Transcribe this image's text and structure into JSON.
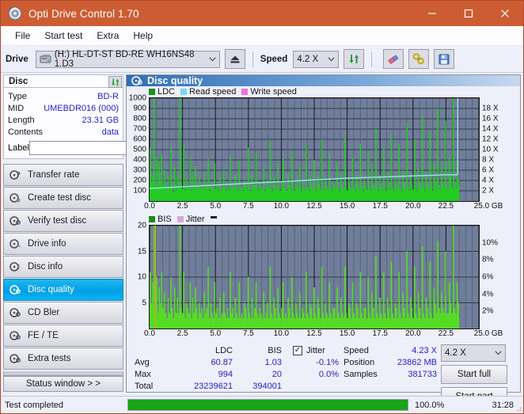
{
  "window": {
    "title": "Opti Drive Control 1.70",
    "icon": "disc-icon",
    "minimize": "—",
    "maximize": "☐",
    "close": "✕",
    "titlebar_color": "#cc5d33"
  },
  "menu": {
    "items": [
      "File",
      "Start test",
      "Extra",
      "Help"
    ]
  },
  "toolbar": {
    "drive_label": "Drive",
    "drive_value": "(H:)  HL-DT-ST BD-RE  WH16NS48 1.D3",
    "eject_icon": "eject-icon",
    "speed_label": "Speed",
    "speed_value": "4.2 X",
    "refresh_icon": "refresh-icon",
    "erase_icon": "eraser-icon",
    "tools_icon": "tools-icon",
    "save_icon": "save-icon",
    "chevron": "⌄"
  },
  "disc": {
    "group_title": "Disc",
    "refresh_icon": "refresh-icon",
    "rows": [
      {
        "key": "Type",
        "value": "BD-R"
      },
      {
        "key": "MID",
        "value": "UMEBDR016 (000)"
      },
      {
        "key": "Length",
        "value": "23.31 GB"
      },
      {
        "key": "Contents",
        "value": "data"
      }
    ],
    "label_key": "Label",
    "label_value": "",
    "label_placeholder": "",
    "label_icon": "cd-icon"
  },
  "nav": {
    "items": [
      {
        "label": "Transfer rate",
        "icon": "disc-rate-icon",
        "active": false
      },
      {
        "label": "Create test disc",
        "icon": "disc-create-icon",
        "active": false
      },
      {
        "label": "Verify test disc",
        "icon": "disc-verify-icon",
        "active": false
      },
      {
        "label": "Drive info",
        "icon": "disc-drive-icon",
        "active": false
      },
      {
        "label": "Disc info",
        "icon": "disc-info-icon",
        "active": false
      },
      {
        "label": "Disc quality",
        "icon": "disc-quality-icon",
        "active": true
      },
      {
        "label": "CD Bler",
        "icon": "disc-bler-icon",
        "active": false
      },
      {
        "label": "FE / TE",
        "icon": "disc-fete-icon",
        "active": false
      },
      {
        "label": "Extra tests",
        "icon": "disc-extra-icon",
        "active": false
      }
    ],
    "status_button": "Status window > >"
  },
  "panel": {
    "title": "Disc quality",
    "icon": "disc-quality-icon"
  },
  "chart_data": [
    {
      "type": "area",
      "name": "top-chart",
      "title": "",
      "xlabel": "GB",
      "ylabel": "",
      "xlim": [
        0,
        25
      ],
      "ylim": [
        0,
        1000
      ],
      "y2lim": [
        0,
        18
      ],
      "grid": true,
      "legend_position": "top-left",
      "legend": [
        {
          "label": "LDC",
          "color": "#1a8f1a"
        },
        {
          "label": "Read speed",
          "color": "#7fd4f0"
        },
        {
          "label": "Write speed",
          "color": "#f070d8"
        }
      ],
      "xticks": [
        "0.0",
        "2.5",
        "5.0",
        "7.5",
        "10.0",
        "12.5",
        "15.0",
        "17.5",
        "20.0",
        "22.5",
        "25.0"
      ],
      "yticks": [
        100,
        200,
        300,
        400,
        500,
        600,
        700,
        800,
        900,
        1000
      ],
      "y2ticks": [
        "2 X",
        "4 X",
        "6 X",
        "8 X",
        "10 X",
        "12 X",
        "14 X",
        "16 X",
        "18 X"
      ],
      "xunit": "GB",
      "series": [
        {
          "name": "LDC",
          "color": "#22cc22",
          "x_end": 23.5,
          "baseline": 90,
          "values": [
            520,
            180,
            240,
            1000,
            150,
            430,
            120,
            380,
            200,
            460,
            140,
            300,
            170,
            110,
            250,
            130,
            520,
            160,
            90,
            330,
            110,
            240,
            140,
            1000,
            180,
            120,
            560,
            100,
            210,
            150,
            130,
            420,
            100,
            260,
            120,
            340,
            150,
            110,
            230,
            130,
            170,
            110,
            280,
            120,
            150,
            420,
            100,
            190,
            130,
            110,
            370,
            120,
            160,
            100,
            230,
            110,
            140,
            300,
            120,
            100,
            180,
            110,
            440,
            120,
            150,
            110,
            260,
            130,
            100,
            390,
            110,
            140,
            100,
            200,
            170,
            110,
            520,
            130,
            100,
            250,
            110,
            160,
            470,
            120,
            100,
            180,
            140,
            110,
            320,
            100,
            130,
            200,
            110,
            580,
            120,
            100,
            240,
            150,
            110,
            360,
            120,
            100,
            190,
            420,
            110,
            130,
            100,
            270,
            160,
            110,
            480,
            120,
            100,
            210,
            140,
            110,
            340,
            100,
            180,
            120,
            110,
            540,
            130,
            100,
            230,
            150,
            110,
            400,
            120,
            100,
            260,
            170,
            110,
            600,
            120,
            100,
            210,
            140,
            110,
            460,
            130,
            100,
            190,
            160,
            110,
            380,
            120,
            100,
            280,
            140,
            110,
            620,
            130,
            100,
            220,
            150,
            110,
            430,
            120,
            100,
            240,
            170,
            110,
            560,
            130,
            100,
            200,
            150,
            110,
            480,
            120,
            100,
            320,
            160,
            110,
            700,
            130,
            100,
            250,
            140,
            110,
            520,
            120,
            100,
            280,
            170,
            110,
            640,
            130,
            100,
            230,
            150,
            110,
            560,
            120,
            100,
            300,
            180,
            110,
            760,
            140,
            100,
            260,
            160,
            110,
            600,
            130,
            100,
            320,
            190,
            110,
            820,
            150,
            100,
            280,
            170,
            110,
            680,
            140,
            100,
            360,
            200,
            120,
            900,
            160,
            110,
            340,
            190,
            120,
            780,
            150,
            110,
            420,
            230,
            130,
            1000,
            180,
            120,
            400,
            210
          ]
        },
        {
          "name": "Read speed",
          "color": "#9fe3f7",
          "note": "rising step curve from ~2.2X to ~4.6X across disc, vertical spike to 18X at ~23.4 GB",
          "points": [
            [
              0,
              2.2
            ],
            [
              2.5,
              2.5
            ],
            [
              5.0,
              2.8
            ],
            [
              7.5,
              3.1
            ],
            [
              10.0,
              3.4
            ],
            [
              12.5,
              3.7
            ],
            [
              15.0,
              4.0
            ],
            [
              17.5,
              4.2
            ],
            [
              20.0,
              4.4
            ],
            [
              22.5,
              4.6
            ],
            [
              23.4,
              4.6
            ]
          ]
        }
      ]
    },
    {
      "type": "area",
      "name": "bottom-chart",
      "title": "",
      "xlabel": "GB",
      "ylabel": "",
      "xlim": [
        0,
        25
      ],
      "ylim": [
        0,
        20
      ],
      "y2lim": [
        0,
        10
      ],
      "grid": true,
      "legend_position": "top-left",
      "legend": [
        {
          "label": "BIS",
          "color": "#1a8f1a"
        },
        {
          "label": "Jitter",
          "color": "#d9a8d9"
        }
      ],
      "xticks": [
        "0.0",
        "2.5",
        "5.0",
        "7.5",
        "10.0",
        "12.5",
        "15.0",
        "17.5",
        "20.0",
        "22.5",
        "25.0"
      ],
      "yticks": [
        5,
        10,
        15,
        20
      ],
      "y2ticks": [
        "2%",
        "4%",
        "6%",
        "8%",
        "10%"
      ],
      "xunit": "GB",
      "series": [
        {
          "name": "BIS",
          "color": "#55dd22",
          "x_end": 23.5,
          "values": [
            11,
            5,
            9,
            20,
            4,
            10,
            3,
            8,
            5,
            11,
            4,
            7,
            3,
            2,
            6,
            3,
            10,
            4,
            2,
            8,
            3,
            6,
            3,
            20,
            4,
            3,
            11,
            2,
            5,
            4,
            3,
            9,
            2,
            6,
            3,
            8,
            4,
            2,
            5,
            3,
            4,
            2,
            7,
            3,
            4,
            12,
            2,
            5,
            3,
            2,
            9,
            3,
            4,
            2,
            6,
            2,
            3,
            7,
            3,
            2,
            4,
            2,
            11,
            3,
            4,
            2,
            6,
            3,
            2,
            9,
            2,
            3,
            2,
            5,
            4,
            2,
            10,
            3,
            2,
            6,
            2,
            4,
            9,
            3,
            2,
            4,
            3,
            2,
            7,
            2,
            3,
            5,
            2,
            12,
            3,
            2,
            6,
            4,
            2,
            8,
            3,
            2,
            4,
            9,
            2,
            3,
            2,
            6,
            4,
            2,
            10,
            3,
            2,
            5,
            3,
            2,
            7,
            2,
            4,
            3,
            2,
            11,
            3,
            2,
            5,
            4,
            2,
            8,
            3,
            2,
            6,
            4,
            2,
            12,
            3,
            2,
            5,
            3,
            2,
            9,
            3,
            2,
            4,
            4,
            2,
            8,
            3,
            2,
            6,
            3,
            2,
            12,
            3,
            2,
            5,
            4,
            2,
            9,
            3,
            2,
            5,
            4,
            2,
            11,
            3,
            2,
            4,
            4,
            2,
            10,
            3,
            2,
            7,
            4,
            2,
            14,
            3,
            2,
            6,
            3,
            2,
            11,
            3,
            2,
            6,
            4,
            2,
            13,
            3,
            2,
            5,
            4,
            2,
            11,
            3,
            2,
            7,
            4,
            2,
            15,
            3,
            2,
            6,
            4,
            2,
            12,
            3,
            2,
            7,
            4,
            2,
            16,
            3,
            2,
            6,
            4,
            2,
            13,
            3,
            2,
            8,
            5,
            3,
            17,
            4,
            3,
            7,
            4,
            3,
            15,
            3,
            3,
            9,
            5,
            3,
            20,
            4,
            3,
            9,
            5
          ]
        },
        {
          "name": "Jitter",
          "color": "#e8a8e8",
          "note": "mostly flat near zero, not visible in this run"
        }
      ],
      "markers": [
        {
          "name": "orange-vertical-line",
          "x": 0.45,
          "color": "#e0a020"
        }
      ]
    }
  ],
  "stats": {
    "col_headers": [
      "LDC",
      "BIS"
    ],
    "row_labels": [
      "Avg",
      "Max",
      "Total"
    ],
    "ldc": {
      "avg": "60.87",
      "max": "994",
      "total": "23239621"
    },
    "bis": {
      "avg": "1.03",
      "max": "20",
      "total": "394001"
    },
    "jitter": {
      "label": "Jitter",
      "checked": true,
      "check_glyph": "✓",
      "avg": "-0.1%",
      "max": "0.0%"
    },
    "right": {
      "speed_label": "Speed",
      "speed_value": "4.23 X",
      "position_label": "Position",
      "position_value": "23862 MB",
      "samples_label": "Samples",
      "samples_value": "381733"
    },
    "speed_select": "4.2 X",
    "chevron": "⌄",
    "start_full": "Start full",
    "start_part": "Start part"
  },
  "statusbar": {
    "text": "Test completed",
    "progress_percent": "100.0%",
    "progress_value": 100,
    "elapsed": "31:28"
  }
}
